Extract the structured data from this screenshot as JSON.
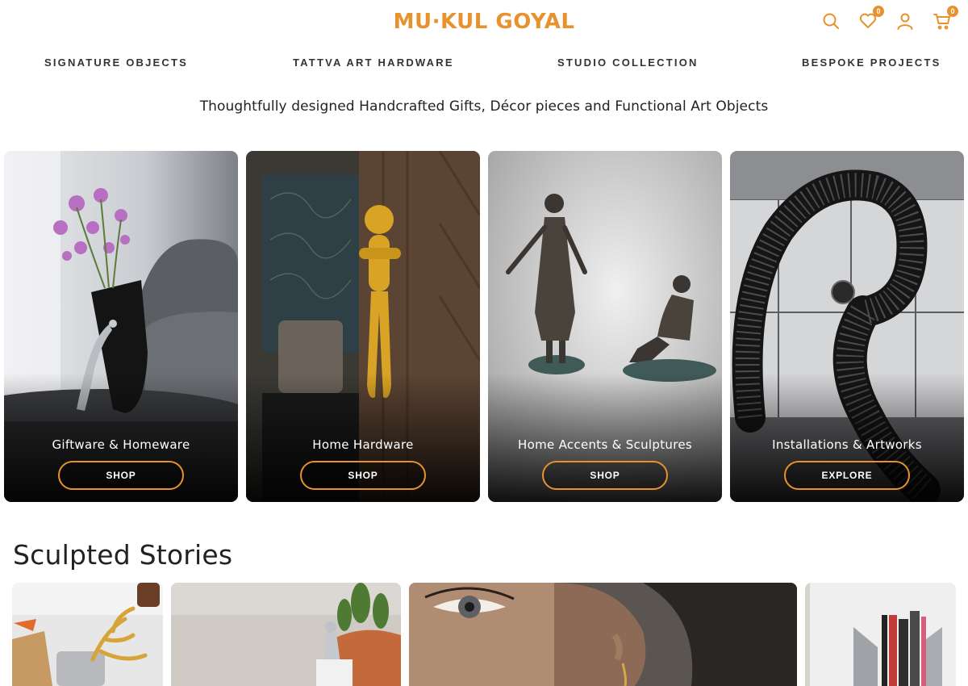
{
  "header": {
    "logo": "MU·KUL GOYAL",
    "wishlist_count": "0",
    "cart_count": "0"
  },
  "nav": {
    "items": [
      "SIGNATURE OBJECTS",
      "TATTVA ART HARDWARE",
      "STUDIO COLLECTION",
      "BESPOKE PROJECTS"
    ]
  },
  "tagline": "Thoughtfully designed Handcrafted Gifts, Décor pieces and Functional Art Objects",
  "categories": [
    {
      "title": "Giftware & Homeware",
      "button": "SHOP"
    },
    {
      "title": "Home Hardware",
      "button": "SHOP"
    },
    {
      "title": "Home Accents & Sculptures",
      "button": "SHOP"
    },
    {
      "title": "Installations & Artworks",
      "button": "EXPLORE"
    }
  ],
  "stories": {
    "title": "Sculpted Stories"
  },
  "colors": {
    "accent": "#E8922E",
    "text": "#222222",
    "background": "#FFFFFF"
  },
  "icons": {
    "search": "search-icon",
    "wishlist": "heart-icon",
    "account": "user-icon",
    "cart": "cart-icon"
  }
}
